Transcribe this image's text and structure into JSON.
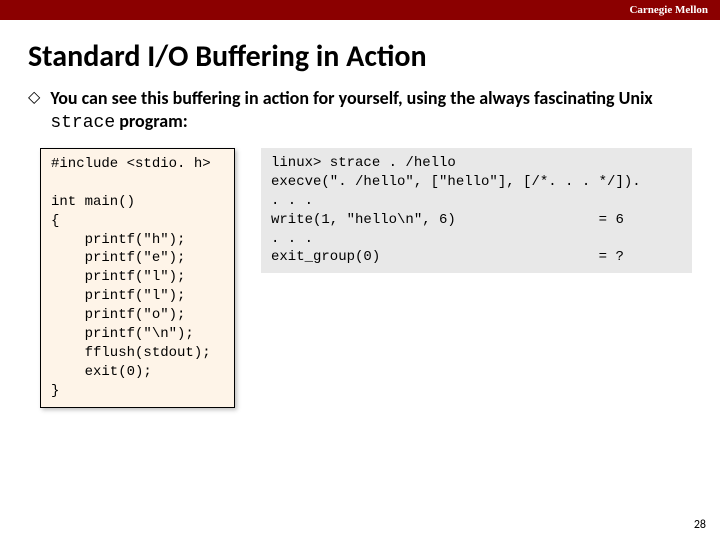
{
  "header": {
    "institution": "Carnegie Mellon"
  },
  "title": "Standard I/O Buffering in Action",
  "bullet": {
    "text_before": "You can see this buffering in action for yourself, using the always fascinating Unix ",
    "code_word": "strace",
    "text_after": " program:"
  },
  "code_left": "#include <stdio. h>\n\nint main()\n{\n    printf(\"h\");\n    printf(\"e\");\n    printf(\"l\");\n    printf(\"l\");\n    printf(\"o\");\n    printf(\"\\n\");\n    fflush(stdout);\n    exit(0);\n}",
  "code_right": "linux> strace . /hello\nexecve(\". /hello\", [\"hello\"], [/*. . . */]).\n. . .\nwrite(1, \"hello\\n\", 6)                 = 6\n. . .\nexit_group(0)                          = ?",
  "page_number": "28"
}
